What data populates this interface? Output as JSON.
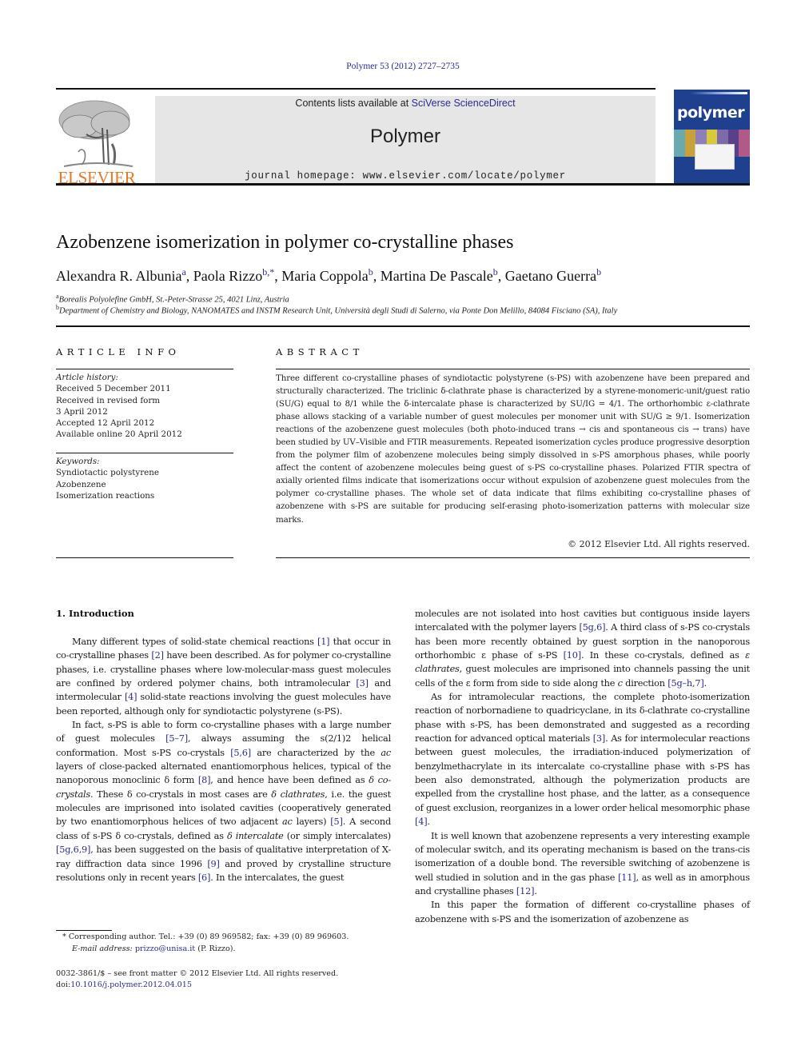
{
  "header": {
    "citation": "Polymer 53 (2012) 2727–2735",
    "contents_prefix": "Contents lists available at ",
    "contents_link": "SciVerse ScienceDirect",
    "journal_title": "Polymer",
    "homepage": "journal homepage: www.elsevier.com/locate/polymer",
    "publisher_logo": "ELSEVIER",
    "cover_title": "polymer",
    "colors": {
      "elsevier_orange": "#e87722",
      "link_blue": "#2b2b8f",
      "banner_gray": "#e6e6e6",
      "cover_blue": "#1f3f8f"
    }
  },
  "article": {
    "title": "Azobenzene isomerization in polymer co-crystalline phases",
    "authors": [
      {
        "name": "Alexandra R. Albunia",
        "sup": "a"
      },
      {
        "name": "Paola Rizzo",
        "sup": "b,*"
      },
      {
        "name": "Maria Coppola",
        "sup": "b"
      },
      {
        "name": "Martina De Pascale",
        "sup": "b"
      },
      {
        "name": "Gaetano Guerra",
        "sup": "b"
      }
    ],
    "affiliations": [
      {
        "sup": "a",
        "text": "Borealis Polyolefine GmbH, St.-Peter-Strasse 25, 4021 Linz, Austria"
      },
      {
        "sup": "b",
        "text": "Department of Chemistry and Biology, NANOMATES and INSTM Research Unit, Università degli Studi di Salerno, via Ponte Don Melillo, 84084 Fisciano (SA), Italy"
      }
    ]
  },
  "article_info": {
    "heading": "ARTICLE INFO",
    "history_label": "Article history:",
    "history": [
      "Received 5 December 2011",
      "Received in revised form",
      "3 April 2012",
      "Accepted 12 April 2012",
      "Available online 20 April 2012"
    ],
    "keywords_label": "Keywords:",
    "keywords": [
      "Syndiotactic polystyrene",
      "Azobenzene",
      "Isomerization reactions"
    ]
  },
  "abstract": {
    "heading": "ABSTRACT",
    "text": "Three different co-crystalline phases of syndiotactic polystyrene (s-PS) with azobenzene have been prepared and structurally characterized. The triclinic δ-clathrate phase is characterized by a styrene-monomeric-unit/guest ratio (SU/G) equal to 8/1 while the δ-intercalate phase is characterized by SU/IG = 4/1. The orthorhombic ε-clathrate phase allows stacking of a variable number of guest molecules per monomer unit with SU/G ≥ 9/1. Isomerization reactions of the azobenzene guest molecules (both photo-induced trans → cis and spontaneous cis → trans) have been studied by UV–Visible and FTIR measurements. Repeated isomerization cycles produce progressive desorption from the polymer film of azobenzene molecules being simply dissolved in s-PS amorphous phases, while poorly affect the content of azobenzene molecules being guest of s-PS co-crystalline phases. Polarized FTIR spectra of axially oriented films indicate that isomerizations occur without expulsion of azobenzene guest molecules from the polymer co-crystalline phases. The whole set of data indicate that films exhibiting co-crystalline phases of azobenzene with s-PS are suitable for producing self-erasing photo-isomerization patterns with molecular size marks.",
    "copyright": "© 2012 Elsevier Ltd. All rights reserved."
  },
  "body": {
    "section_heading": "1.  Introduction",
    "left_paragraphs": [
      [
        {
          "t": "Many different types of solid-state chemical reactions "
        },
        {
          "r": "[1]"
        },
        {
          "t": " that occur in co-crystalline phases "
        },
        {
          "r": "[2]"
        },
        {
          "t": " have been described. As for polymer co-crystalline phases, i.e. crystalline phases where low-molecular-mass guest molecules are confined by ordered polymer chains, both intramolecular "
        },
        {
          "r": "[3]"
        },
        {
          "t": " and intermolecular "
        },
        {
          "r": "[4]"
        },
        {
          "t": " solid-state reactions involving the guest molecules have been reported, although only for syndiotactic polystyrene (s-PS)."
        }
      ],
      [
        {
          "t": "In fact, s-PS is able to form co-crystalline phases with a large number of guest molecules "
        },
        {
          "r": "[5–7]"
        },
        {
          "t": ", always assuming the s(2/1)2 helical conformation. Most s-PS co-crystals "
        },
        {
          "r": "[5,6]"
        },
        {
          "t": " are characterized by the "
        },
        {
          "i": "ac"
        },
        {
          "t": " layers of close-packed alternated enantiomorphous helices, typical of the nanoporous monoclinic δ form "
        },
        {
          "r": "[8]"
        },
        {
          "t": ", and hence have been defined as "
        },
        {
          "i": "δ co-crystals"
        },
        {
          "t": ". These δ co-crystals in most cases are "
        },
        {
          "i": "δ clathrates"
        },
        {
          "t": ", i.e. the guest molecules are imprisoned into isolated cavities (cooperatively generated by two enantiomorphous helices of two adjacent "
        },
        {
          "i": "ac"
        },
        {
          "t": " layers) "
        },
        {
          "r": "[5]"
        },
        {
          "t": ". A second class of s-PS δ co-crystals, defined as "
        },
        {
          "i": "δ intercalate"
        },
        {
          "t": " (or simply intercalates) "
        },
        {
          "r": "[5g,6,9]"
        },
        {
          "t": ", has been suggested on the basis of qualitative interpretation of X-ray diffraction data since 1996 "
        },
        {
          "r": "[9]"
        },
        {
          "t": " and proved by crystalline structure resolutions only in recent years "
        },
        {
          "r": "[6]"
        },
        {
          "t": ". In the intercalates, the guest"
        }
      ]
    ],
    "right_paragraphs": [
      [
        {
          "t": "molecules are not isolated into host cavities but contiguous inside layers intercalated with the polymer layers "
        },
        {
          "r": "[5g,6]"
        },
        {
          "t": ". A third class of s-PS co-crystals has been more recently obtained by guest sorption in the nanoporous orthorhombic ε phase of s-PS "
        },
        {
          "r": "[10]"
        },
        {
          "t": ". In these co-crystals, defined as "
        },
        {
          "i": "ε clathrates"
        },
        {
          "t": ", guest molecules are imprisoned into channels passing the unit cells of the ε form from side to side along the "
        },
        {
          "i": "c"
        },
        {
          "t": " direction "
        },
        {
          "r": "[5g–h,7]"
        },
        {
          "t": "."
        }
      ],
      [
        {
          "t": "As for intramolecular reactions, the complete photo-isomerization reaction of norbornadiene to quadricyclane, in its δ-clathrate co-crystalline phase with s-PS, has been demonstrated and suggested as a recording reaction for advanced optical materials "
        },
        {
          "r": "[3]"
        },
        {
          "t": ". As for intermolecular reactions between guest molecules, the irradiation-induced polymerization of benzylmethacrylate in its intercalate co-crystalline phase with s-PS has been also demonstrated, although the polymerization products are expelled from the crystalline host phase, and the latter, as a consequence of guest exclusion, reorganizes in a lower order helical mesomorphic phase "
        },
        {
          "r": "[4]"
        },
        {
          "t": "."
        }
      ],
      [
        {
          "t": "It is well known that azobenzene represents a very interesting example of molecular switch, and its operating mechanism is based on the trans-cis isomerization of a double bond. The reversible switching of azobenzene is well studied in solution and in the gas phase "
        },
        {
          "r": "[11]"
        },
        {
          "t": ", as well as in amorphous and crystalline phases "
        },
        {
          "r": "[12]"
        },
        {
          "t": "."
        }
      ],
      [
        {
          "t": "In this paper the formation of different co-crystalline phases of azobenzene with s-PS and the isomerization of azobenzene as"
        }
      ]
    ]
  },
  "footnotes": {
    "corresponding": "*  Corresponding author. Tel.: +39 (0) 89 969582; fax: +39 (0) 89 969603.",
    "email_label": "E-mail address: ",
    "email": "prizzo@unisa.it",
    "email_suffix": " (P. Rizzo).",
    "issn": "0032-3861/$ – see front matter © 2012 Elsevier Ltd. All rights reserved.",
    "doi_label": "doi:",
    "doi": "10.1016/j.polymer.2012.04.015"
  }
}
